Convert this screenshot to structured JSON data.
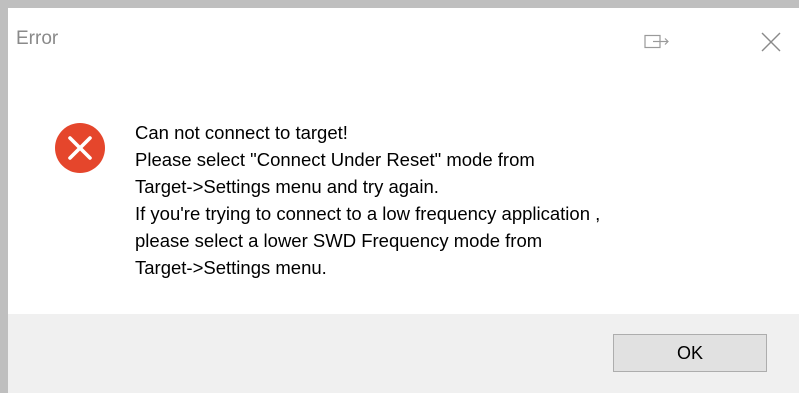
{
  "window": {
    "title": "Error"
  },
  "titlebar": {
    "restore_icon": "restore-window-icon",
    "close_icon": "close-icon"
  },
  "dialog": {
    "icon": "error-icon",
    "message_lines": [
      "Can not connect to target!",
      "Please select \"Connect Under Reset\" mode from",
      "Target->Settings menu and try again.",
      "If you're trying to connect to a low frequency application ,",
      "please select a lower SWD Frequency mode from",
      "Target->Settings menu."
    ]
  },
  "buttons": {
    "ok_label": "OK"
  },
  "colors": {
    "error_red": "#e5462c",
    "footer_bg": "#f0f0f0",
    "button_bg": "#e1e1e1",
    "button_border": "#adadad",
    "title_gray": "#8a8a8a"
  }
}
